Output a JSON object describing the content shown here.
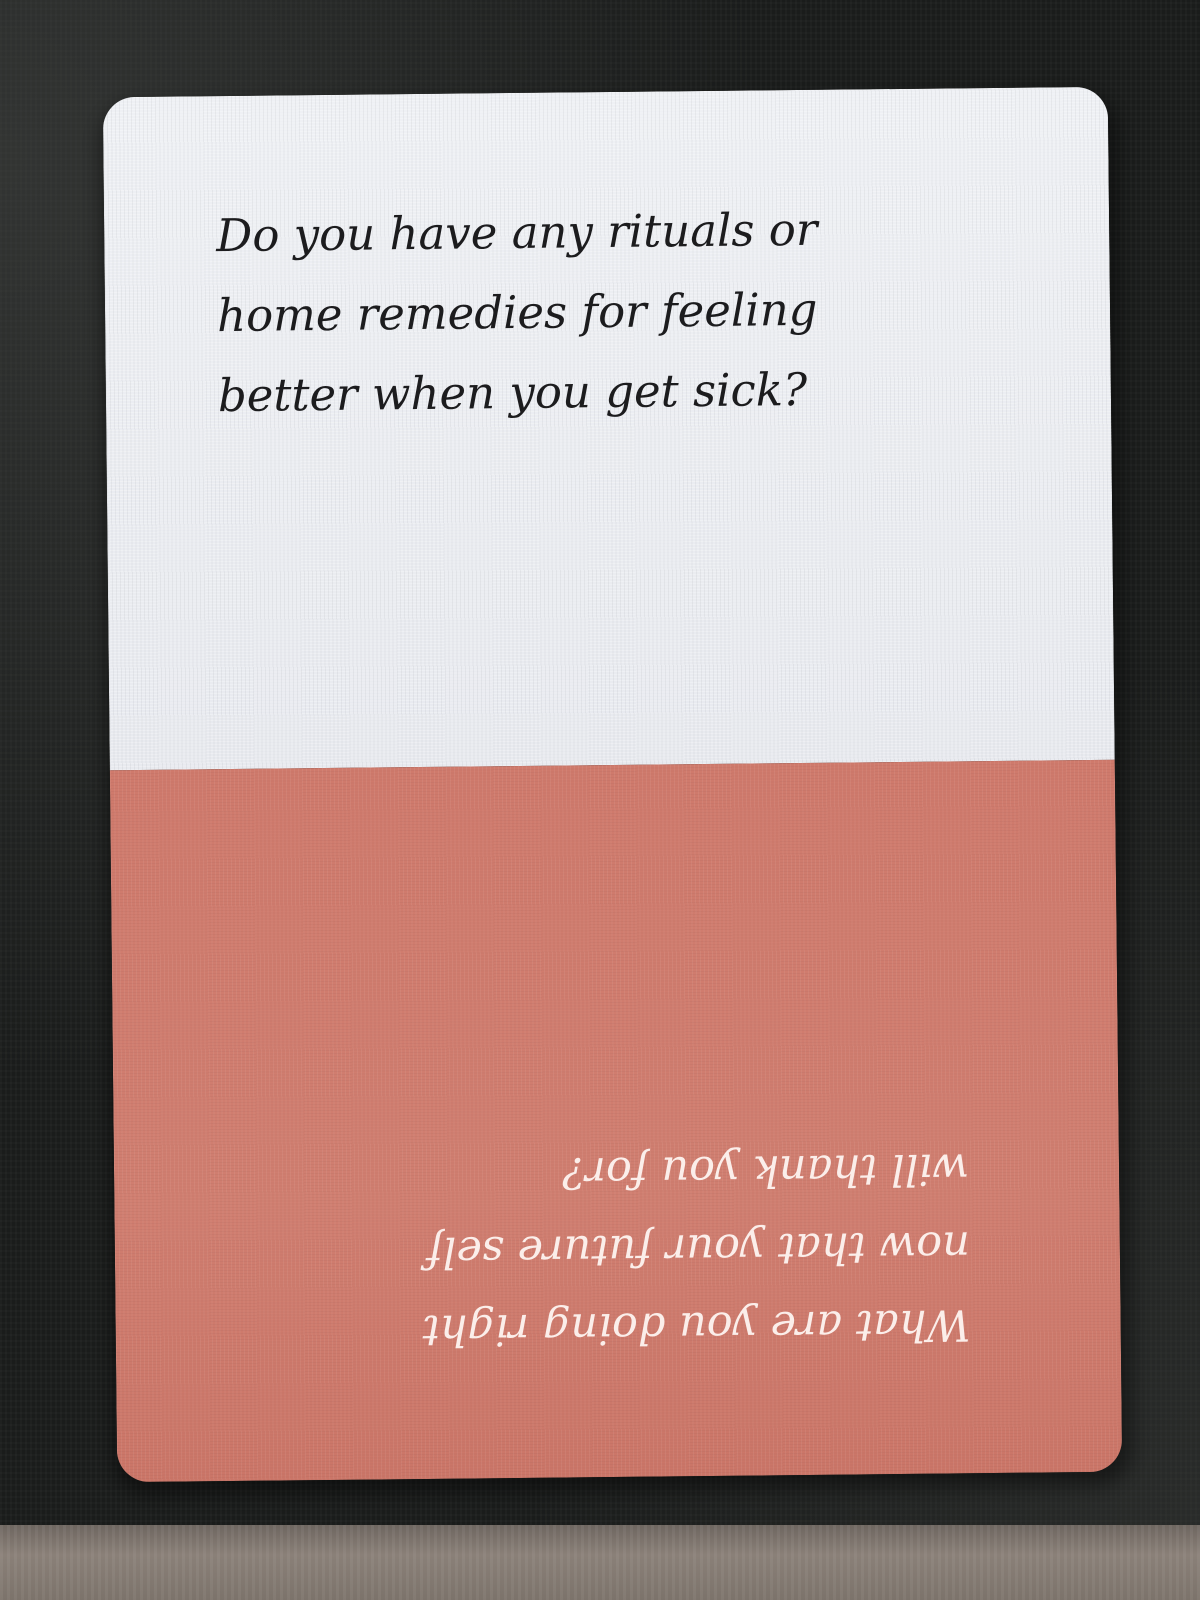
{
  "scene": {
    "description_free": true
  },
  "card": {
    "top_question": "Do you have any rituals or\nhome remedies for feeling\nbetter when you get sick?",
    "bottom_question": "What are you doing right\nnow that your future self\nwill thank you for?",
    "colors": {
      "top_panel": "#eceef2",
      "bottom_panel": "#cf7a6c",
      "top_text": "#1c1c1e",
      "bottom_text": "#fbeeea",
      "background_fabric": "#1a1c1b"
    }
  }
}
